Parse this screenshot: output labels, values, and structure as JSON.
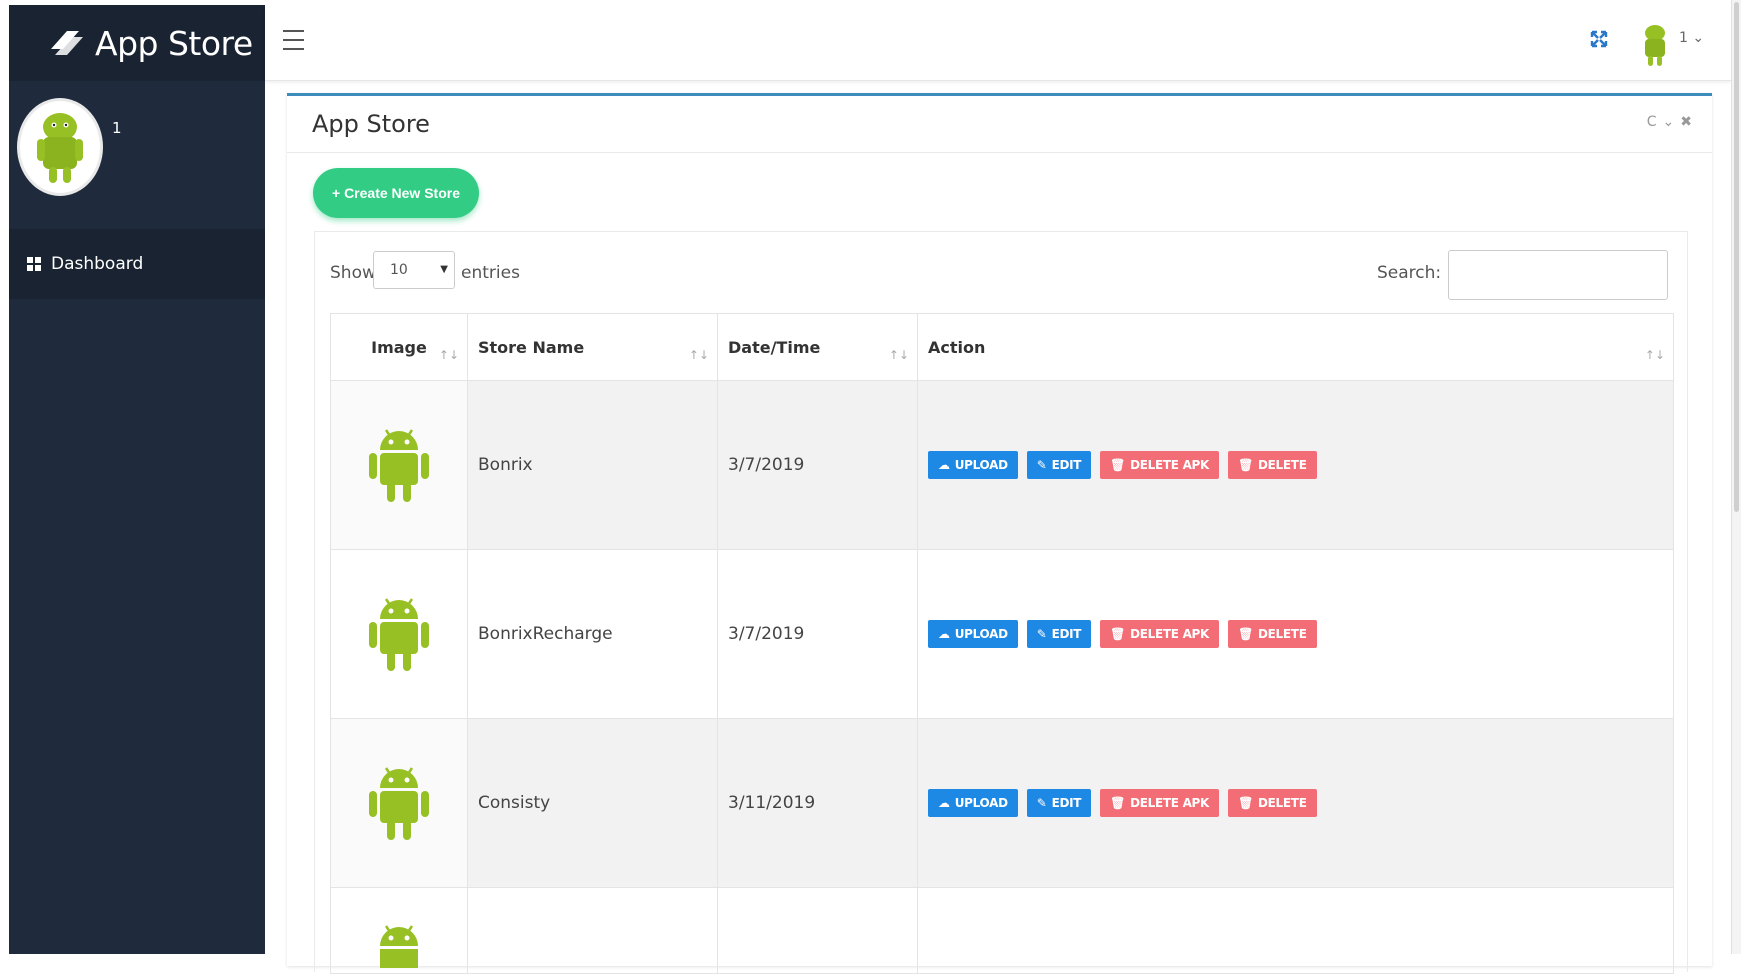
{
  "brand": {
    "name": "App Store"
  },
  "profile": {
    "name": "1"
  },
  "sidebar": {
    "items": [
      {
        "label": "Dashboard",
        "icon": "dashboard-icon"
      }
    ]
  },
  "topbar": {
    "user": "1 ⌄"
  },
  "panel": {
    "title": "App Store",
    "tools": {
      "refresh": "C",
      "collapse": "⌄",
      "close": "✖"
    },
    "create_label": "+ Create New Store"
  },
  "table_controls": {
    "show_label": "Show",
    "length_value": "10",
    "entries_label": "entries",
    "search_label": "Search:"
  },
  "table": {
    "columns": [
      "Image",
      "Store Name",
      "Date/Time",
      "Action"
    ],
    "sort_glyph": "↑↓",
    "rows": [
      {
        "store_name": "Bonrix",
        "date": "3/7/2019"
      },
      {
        "store_name": "BonrixRecharge",
        "date": "3/7/2019"
      },
      {
        "store_name": "Consisty",
        "date": "3/11/2019"
      }
    ],
    "actions": {
      "upload": "UPLOAD",
      "edit": "EDIT",
      "delete_apk": "DELETE APK",
      "delete": "DELETE"
    }
  },
  "colors": {
    "sidebar": "#1f2a3d",
    "accent": "#3c8dbc",
    "create": "#33cc85",
    "blue_btn": "#1e88e5",
    "red_btn": "#f26d75",
    "android": "#97c024"
  }
}
